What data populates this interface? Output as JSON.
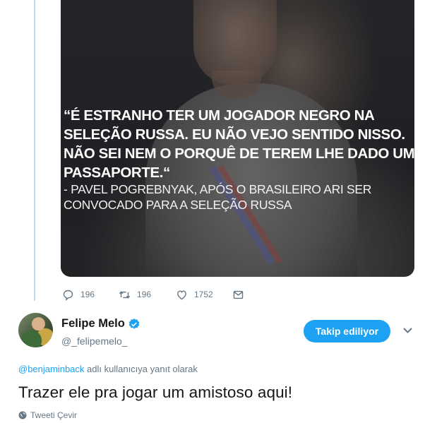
{
  "media": {
    "quote_lines": [
      "“É ESTRANHO TER UM JOGADOR NEGRO NA",
      "SELEÇÃO RUSSA. EU NÃO VEJO SENTIDO NISSO.",
      "NÃO SEI NEM O PORQUÊ DE TEREM LHE DADO UM",
      "PASSAPORTE.“"
    ],
    "attribution_lines": [
      "- PAVEL POGREBNYAK, APÓS O BRASILEIRO ARI SER",
      "CONVOCADO PARA A SELEÇÃO RUSSA"
    ]
  },
  "actions": {
    "reply_count": "196",
    "retweet_count": "196",
    "like_count": "1752",
    "icons": [
      "reply-icon",
      "retweet-icon",
      "like-icon",
      "dm-icon"
    ]
  },
  "author": {
    "name": "Felipe Melo",
    "handle": "@_felipemelo_",
    "verified": true,
    "follow_label": "Takip ediliyor"
  },
  "reply": {
    "mention": "@benjaminback",
    "context": " adlı kullanıcıya yanıt olarak"
  },
  "tweet": {
    "text": "Trazer ele pra jogar um amistoso aqui!",
    "translate_label": "Tweeti Çevir"
  },
  "colors": {
    "accent": "#1da1f2",
    "muted": "#657786",
    "thread_line": "#c4dbe9"
  }
}
